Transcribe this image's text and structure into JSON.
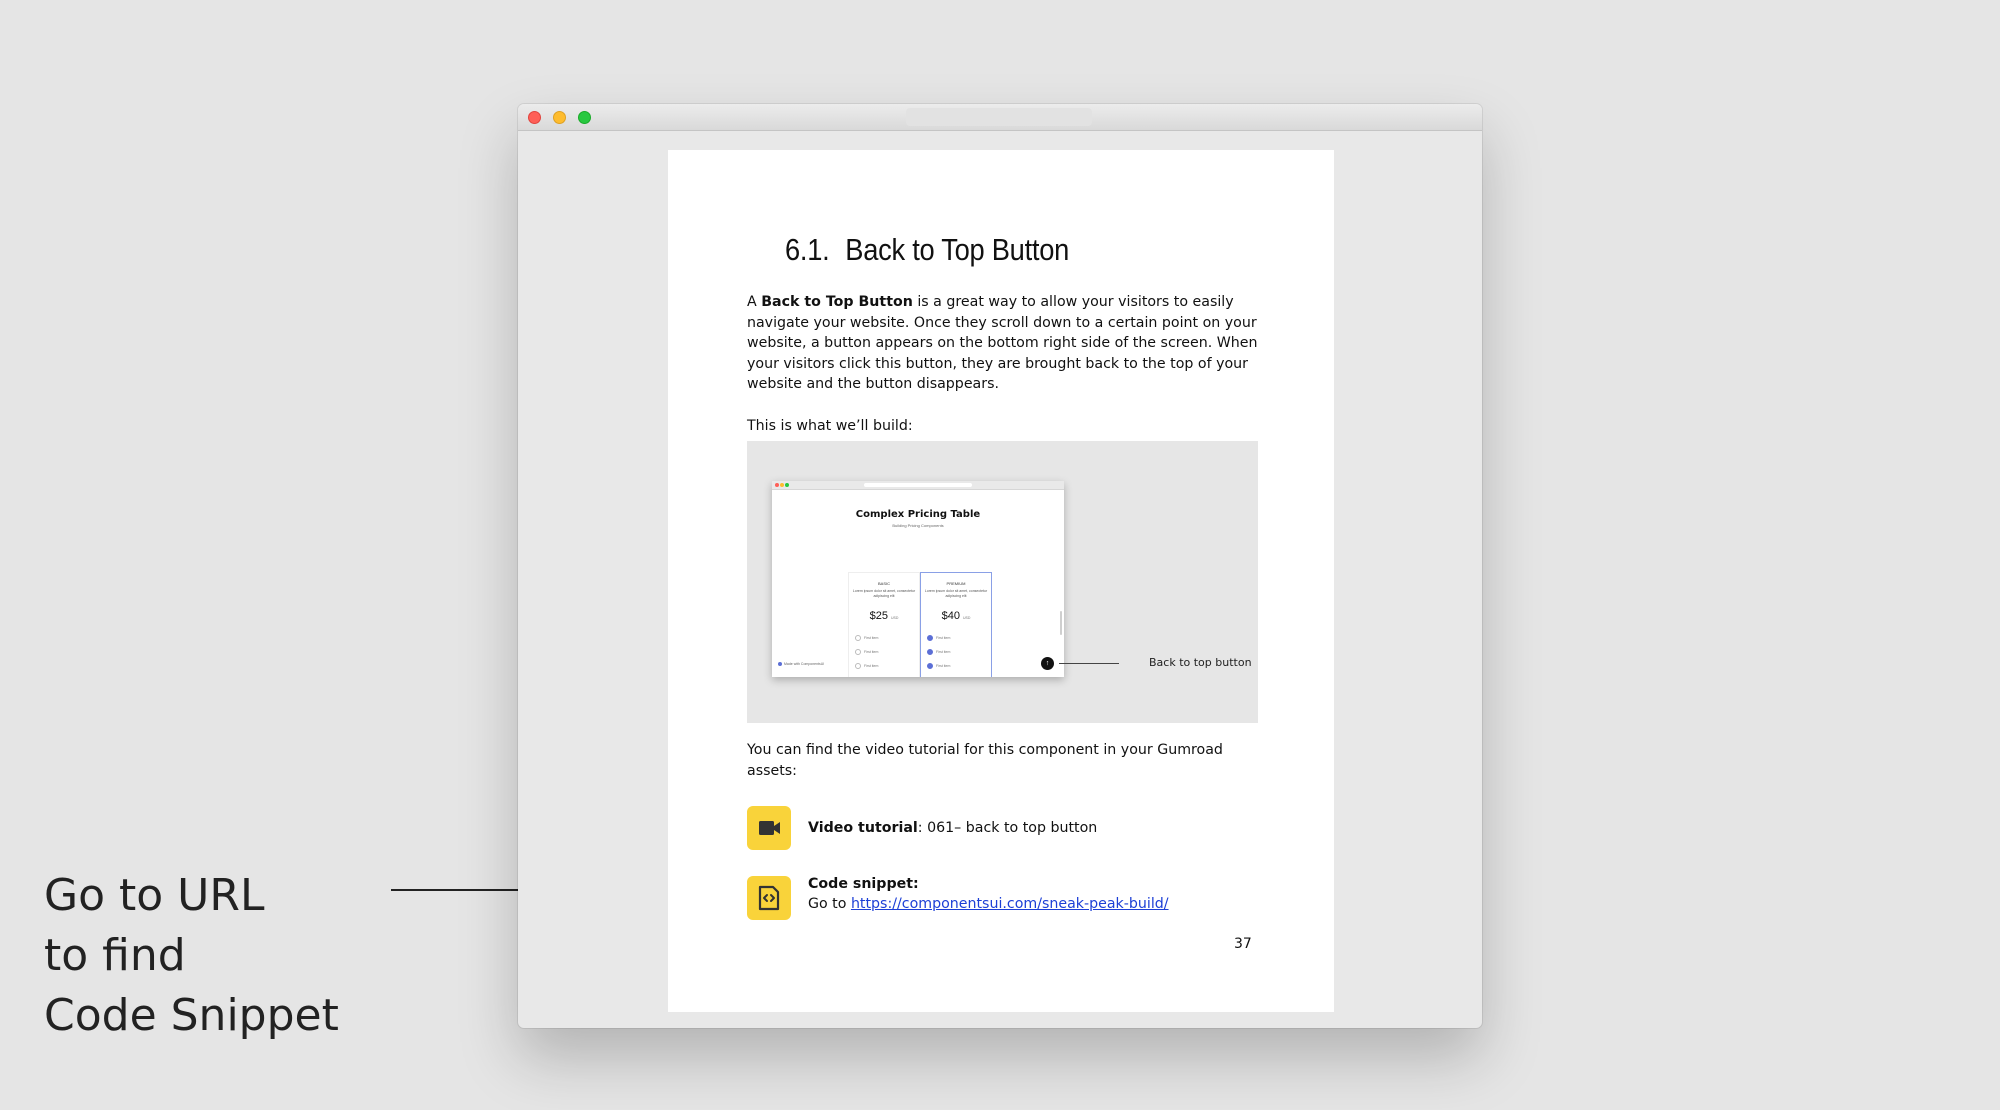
{
  "annotation": {
    "lines": [
      "Go to URL",
      "to find",
      "Code Snippet"
    ]
  },
  "document": {
    "heading_number": "6.1.",
    "heading_title": "Back to Top Button",
    "intro": {
      "prefix": "A ",
      "bold": "Back to Top Button",
      "rest": " is a great way to allow your visitors to easily navigate your website. Once they scroll down to a certain point on your website, a button appears on the bottom right side of the screen. When your visitors click this button, they are brought back to the top of your website and the button disappears."
    },
    "build_label": "This is what we’ll build:",
    "figure": {
      "title": "Complex Pricing Table",
      "subtitle": "Building Pricing Components",
      "callout": "Back to top button",
      "plans": [
        {
          "name": "BASIC",
          "desc": "Lorem ipsum dolor sit amet, consectetur adipiscing elit",
          "price": "$25",
          "unit": "USD",
          "items": [
            "First item",
            "First item",
            "First item"
          ]
        },
        {
          "name": "PREMIUM",
          "desc": "Lorem ipsum dolor sit amet, consectetur adipiscing elit",
          "price": "$40",
          "unit": "USD",
          "items": [
            "First item",
            "First item",
            "First item"
          ]
        }
      ],
      "footer": "Made with ComponentsUI"
    },
    "find_text": "You can find the video tutorial for this component in your Gumroad assets:",
    "video": {
      "label": "Video tutorial",
      "value": ": 061– back to top button",
      "icon": "video-camera-icon"
    },
    "code": {
      "label": "Code snippet:",
      "prefix": "Go to ",
      "url": "https://componentsui.com/sneak-peak-build/",
      "icon": "code-file-icon"
    },
    "page_number": "37"
  },
  "colors": {
    "icon_bg": "#f9d33a",
    "link": "#1c3fd6",
    "background": "#e5e5e5"
  }
}
